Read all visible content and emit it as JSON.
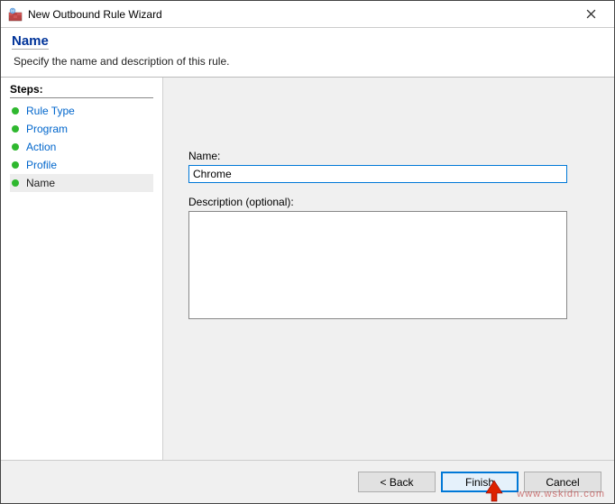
{
  "window": {
    "title": "New Outbound Rule Wizard"
  },
  "header": {
    "title": "Name",
    "subtitle": "Specify the name and description of this rule."
  },
  "sidebar": {
    "heading": "Steps:",
    "items": [
      {
        "label": "Rule Type"
      },
      {
        "label": "Program"
      },
      {
        "label": "Action"
      },
      {
        "label": "Profile"
      },
      {
        "label": "Name"
      }
    ]
  },
  "form": {
    "name_label": "Name:",
    "name_value": "Chrome",
    "desc_label": "Description (optional):",
    "desc_value": ""
  },
  "buttons": {
    "back": "< Back",
    "finish": "Finish",
    "cancel": "Cancel"
  },
  "watermark": "www.wskidn.com"
}
